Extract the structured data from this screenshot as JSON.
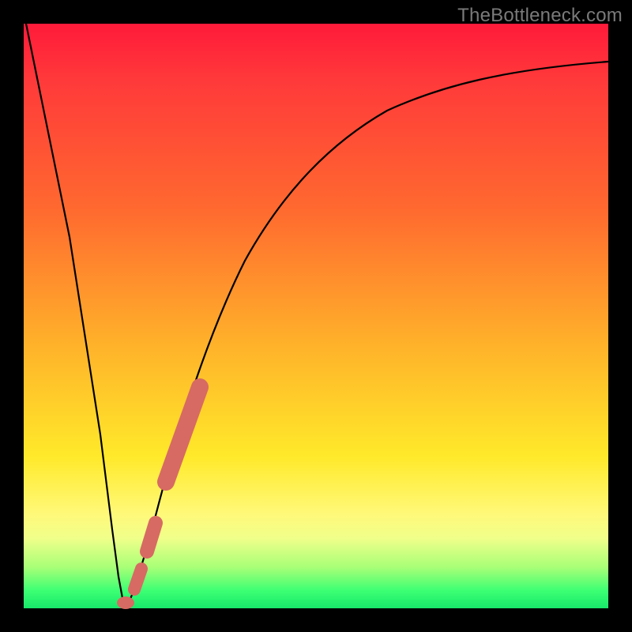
{
  "watermark": "TheBottleneck.com",
  "colors": {
    "frame": "#000000",
    "gradient_top": "#ff1a3a",
    "gradient_bottom": "#17e86a",
    "curve": "#000000",
    "overlay": "#d76a63"
  },
  "chart_data": {
    "type": "line",
    "title": "",
    "xlabel": "",
    "ylabel": "",
    "xlim": [
      0,
      100
    ],
    "ylim": [
      0,
      100
    ],
    "grid": false,
    "legend": false,
    "series": [
      {
        "name": "bottleneck-curve",
        "x": [
          0,
          3,
          6,
          9,
          12,
          14,
          15,
          16,
          17,
          18,
          20,
          23,
          26,
          30,
          35,
          40,
          45,
          50,
          55,
          60,
          67,
          75,
          85,
          95,
          100
        ],
        "y": [
          100,
          82,
          63,
          44,
          24,
          10,
          4,
          1,
          0.3,
          1,
          6,
          16,
          27,
          39,
          51,
          60,
          67,
          72,
          76,
          79,
          83,
          86,
          89,
          91,
          92
        ]
      }
    ],
    "overlay_segments": [
      {
        "name": "highlight-upper",
        "x": [
          23.5,
          28.5
        ],
        "y": [
          18,
          34
        ]
      },
      {
        "name": "highlight-mid",
        "x": [
          20.3,
          21.8
        ],
        "y": [
          7.0,
          11.0
        ]
      },
      {
        "name": "highlight-lower",
        "x": [
          18.0,
          19.2
        ],
        "y": [
          1.2,
          3.8
        ]
      }
    ],
    "overlay_dots": [
      {
        "name": "highlight-bottom-dot",
        "x": 16.2,
        "y": 0.8
      }
    ],
    "annotations": []
  }
}
